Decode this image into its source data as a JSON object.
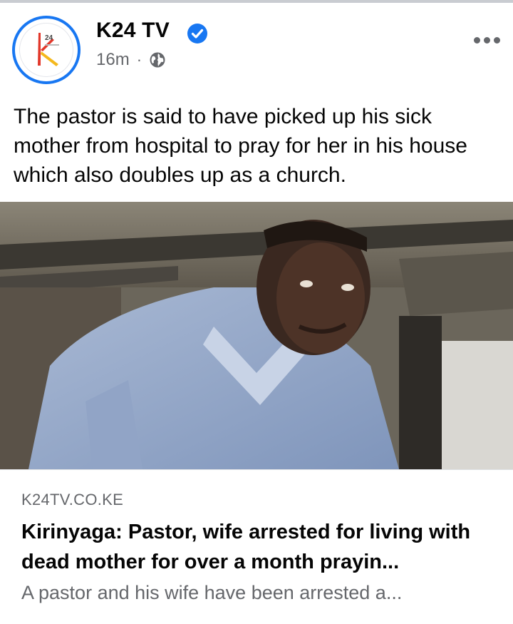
{
  "post": {
    "page_name": "K24 TV",
    "verified": true,
    "time": "16m",
    "audience_icon": "globe-icon",
    "text": "The pastor is said to have picked up his sick mother from hospital to pray for her in his house which also doubles up as a church."
  },
  "link_preview": {
    "domain": "K24TV.CO.KE",
    "headline": "Kirinyaga: Pastor, wife arrested for living with dead mother for over a month prayin...",
    "description": "A pastor and his wife have been arrested a..."
  },
  "colors": {
    "accent": "#1877f2",
    "secondary_text": "#65676b",
    "logo_red": "#e2382b",
    "logo_yellow": "#f4b81d"
  }
}
